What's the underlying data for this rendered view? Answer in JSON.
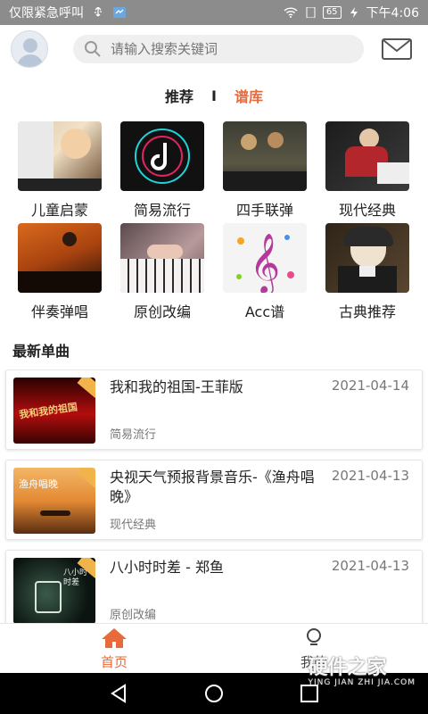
{
  "statusbar": {
    "left_text": "仅限紧急呼叫",
    "battery": "65",
    "time": "下午4:06"
  },
  "header": {
    "search_placeholder": "请输入搜索关键词"
  },
  "tabs": {
    "recommend": "推荐",
    "separator": "I",
    "library": "谱库"
  },
  "categories": [
    {
      "label": "儿童启蒙"
    },
    {
      "label": "简易流行"
    },
    {
      "label": "四手联弹"
    },
    {
      "label": "现代经典"
    },
    {
      "label": "伴奏弹唱"
    },
    {
      "label": "原创改编"
    },
    {
      "label": "Acc谱"
    },
    {
      "label": "古典推荐"
    }
  ],
  "section": {
    "latest_title": "最新单曲"
  },
  "songs": [
    {
      "title": "我和我的祖国-王菲版",
      "date": "2021-04-14",
      "category": "简易流行",
      "cover_text": "我和我的祖国"
    },
    {
      "title": "央视天气预报背景音乐-《渔舟唱晚》",
      "date": "2021-04-13",
      "category": "现代经典",
      "cover_text": "渔舟唱晚"
    },
    {
      "title": "八小时时差 - 郑鱼",
      "date": "2021-04-13",
      "category": "原创改编",
      "cover_text": "八小时时差"
    }
  ],
  "bottomnav": {
    "home": "首页",
    "me": "我的"
  },
  "watermark": {
    "main": "硬件之家",
    "sub": "YING JIAN ZHI JIA.COM"
  },
  "colors": {
    "accent": "#e86a3a"
  }
}
